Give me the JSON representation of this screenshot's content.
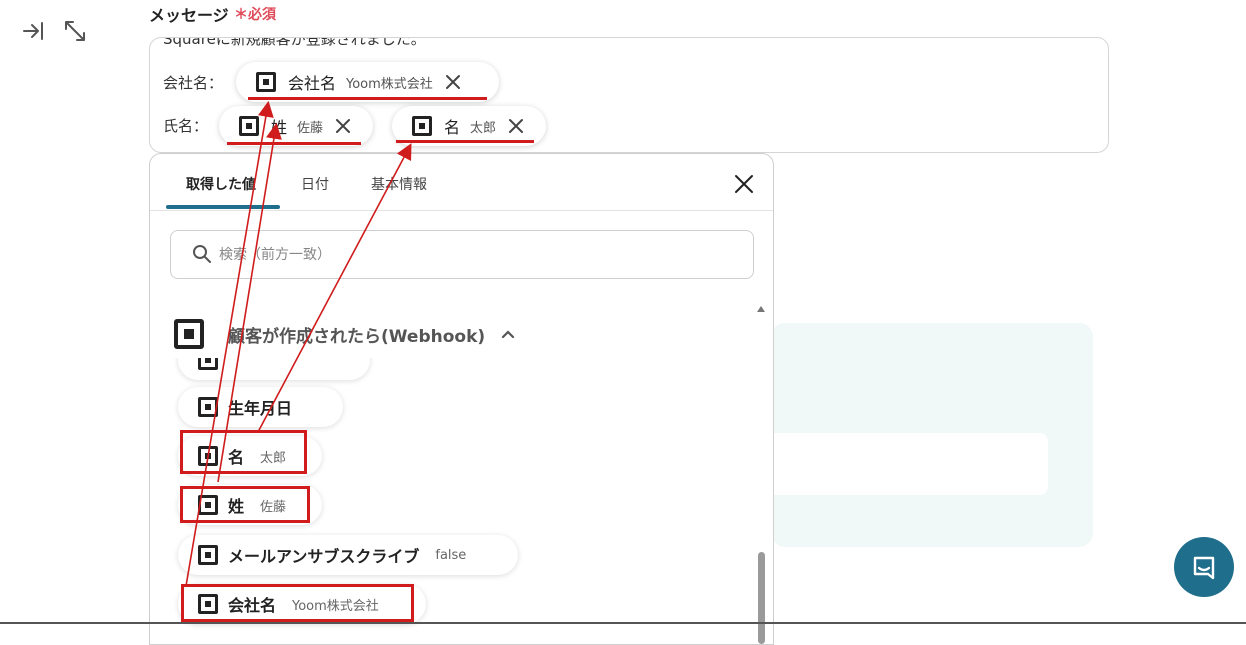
{
  "field": {
    "label": "メッセージ",
    "required_mark": "＊",
    "required_text": "必須"
  },
  "message": {
    "top_text": "Squareに新規顧客が登録されました。",
    "rows": [
      {
        "label": "会社名：",
        "chips": [
          {
            "label": "会社名",
            "value": "Yoom株式会社"
          }
        ]
      },
      {
        "label": "氏名：",
        "chips": [
          {
            "label": "姓",
            "value": "佐藤"
          },
          {
            "label": "名",
            "value": "太郎"
          }
        ]
      }
    ]
  },
  "panel": {
    "tabs": [
      {
        "label": "取得した値",
        "active": true
      },
      {
        "label": "日付",
        "active": false
      },
      {
        "label": "基本情報",
        "active": false
      }
    ],
    "search_placeholder": "検索（前方一致）",
    "section_title": "顧客が作成されたら(Webhook)",
    "items": [
      {
        "label": "生年月日",
        "value": ""
      },
      {
        "label": "名",
        "value": "太郎"
      },
      {
        "label": "姓",
        "value": "佐藤"
      },
      {
        "label": "メールアンサブスクライブ",
        "value": "false"
      },
      {
        "label": "会社名",
        "value": "Yoom株式会社"
      }
    ]
  },
  "colors": {
    "accent": "#1f6e8c",
    "required": "#e04b5a",
    "highlight": "#d01c1c",
    "card_bg": "#f1f8f8"
  },
  "icons": {
    "left_tools": [
      "collapse-right-icon",
      "expand-icon"
    ],
    "chip": "square-logo-icon",
    "chip_remove": "close-icon",
    "panel_close": "close-icon",
    "search": "search-icon",
    "section_toggle": "chevron-up-icon",
    "chat": "chat-icon"
  }
}
